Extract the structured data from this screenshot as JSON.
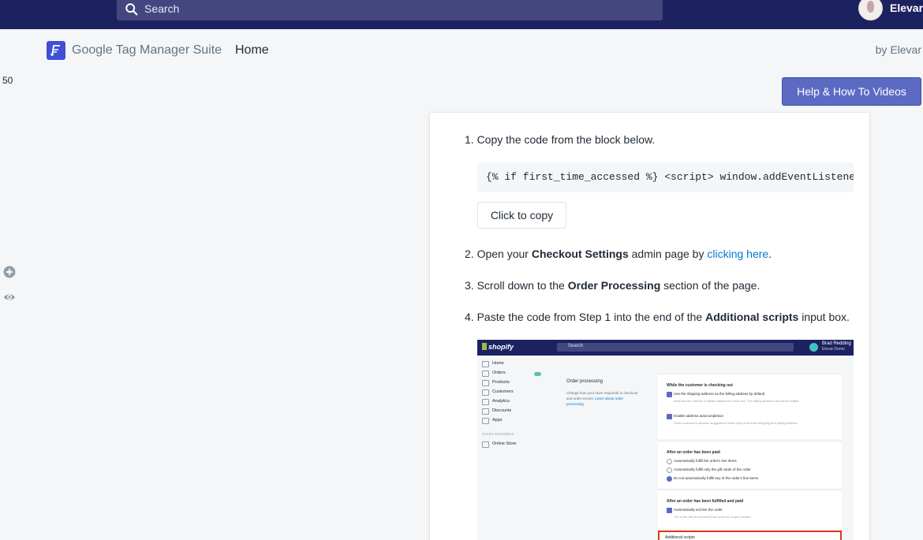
{
  "topbar": {
    "search_placeholder": "Search",
    "user_name": "Elevar",
    "icons": [
      "search-icon",
      "avatar"
    ]
  },
  "appbar": {
    "app_name": "Google Tag Manager Suite",
    "breadcrumb": "Home",
    "byline": "by Elevar"
  },
  "sidebar": {
    "zoom_value": "50",
    "icons": [
      "plus-circle-icon",
      "eye-icon"
    ]
  },
  "help_button": "Help & How To Videos",
  "instructions": {
    "step1": "1. Copy the code from the block below.",
    "code": "{% if first_time_accessed %} <script> window.addEventListener",
    "copy_button": "Click to copy",
    "step2_pre": "2. Open your ",
    "step2_bold": "Checkout Settings",
    "step2_mid": " admin page by ",
    "step2_link": "clicking here",
    "step2_post": ".",
    "step3_pre": "3. Scroll down to the ",
    "step3_bold": "Order Processing",
    "step3_post": " section of the page.",
    "step4_pre": "4. Paste the code from Step 1 into the end of the ",
    "step4_bold": "Additional scripts",
    "step4_post": " input box."
  },
  "screenshot": {
    "brand": "shopify",
    "search": "Search",
    "user_name": "Brad Redding",
    "user_store": "Elevar Demo",
    "nav": [
      "Home",
      "Orders",
      "Products",
      "Customers",
      "Analytics",
      "Discounts",
      "Apps"
    ],
    "sales_channels": "SALES CHANNELS",
    "online_store": "Online Store",
    "section_title": "Order processing",
    "section_desc": "Change how your store responds to checkout and order events.",
    "section_link": "Learn about order processing",
    "checking_out_header": "While the customer is checking out",
    "opt_shipping_billing": "Use the shipping address as the billing address by default",
    "opt_shipping_billing_sub": "Reduces the number of fields required to check out. The billing address can still be edited.",
    "opt_autocomplete": "Enable address autocompletion",
    "opt_autocomplete_sub": "Gives customers address suggestions when they enter their shipping and billing address.",
    "paid_header": "After an order has been paid",
    "paid_opt1": "Automatically fulfill the order's line items",
    "paid_opt2": "Automatically fulfill only the gift cards of the order",
    "paid_opt3": "Do not automatically fulfill any of the order's line items",
    "fulfilled_header": "After an order has been fulfilled and paid",
    "fulfilled_opt": "Automatically archive the order",
    "fulfilled_sub": "The order will be removed from your list of open orders.",
    "additional_scripts": "Additional scripts"
  }
}
